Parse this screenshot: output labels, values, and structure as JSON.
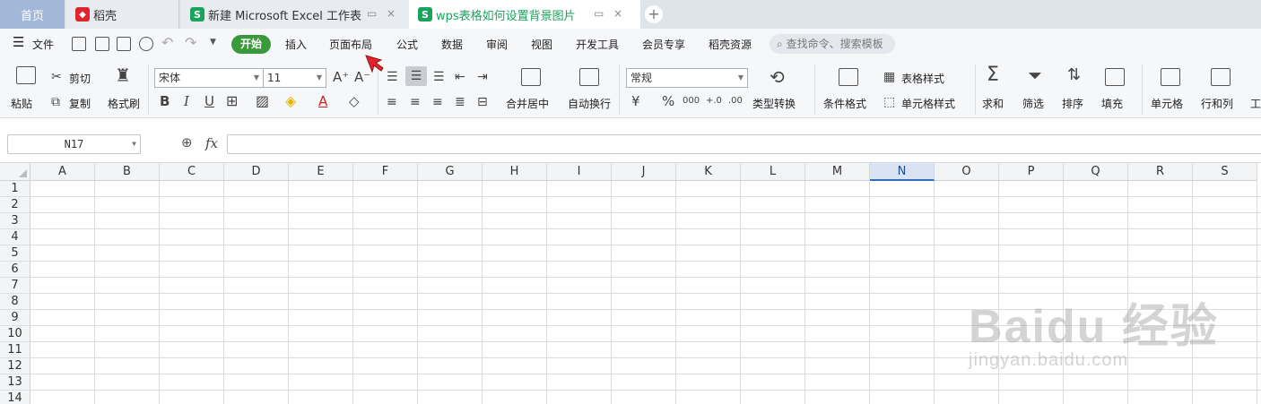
{
  "tabs": {
    "home": "首页",
    "daoke": "稻壳",
    "excel": "新建 Microsoft Excel 工作表",
    "active": "wps表格如何设置背景图片",
    "new_tab": "+",
    "close": "×"
  },
  "menu": {
    "file": "文件",
    "items": [
      "开始",
      "插入",
      "页面布局",
      "公式",
      "数据",
      "审阅",
      "视图",
      "开发工具",
      "会员专享",
      "稻壳资源"
    ],
    "search_placeholder": "查找命令、搜索模板"
  },
  "ribbon": {
    "paste": "粘贴",
    "cut": "剪切",
    "copy": "复制",
    "format_painter": "格式刷",
    "font_name": "宋体",
    "font_size": "11",
    "bold": "B",
    "italic": "I",
    "underline": "U",
    "merge_center": "合并居中",
    "wrap_text": "自动换行",
    "number_format": "常规",
    "currency": "¥",
    "percent": "%",
    "thousands": "000",
    "dec_inc": "+.0",
    "dec_dec": ".00",
    "type_convert": "类型转换",
    "conditional_format": "条件格式",
    "table_style": "表格样式",
    "cell_style": "单元格样式",
    "sum": "求和",
    "filter": "筛选",
    "sort": "排序",
    "fill": "填充",
    "cells": "单元格",
    "rows_cols": "行和列",
    "worksheet_partial": "工"
  },
  "formula": {
    "name_box": "N17",
    "fx": "fx",
    "value": ""
  },
  "grid": {
    "columns": [
      "A",
      "B",
      "C",
      "D",
      "E",
      "F",
      "G",
      "H",
      "I",
      "J",
      "K",
      "L",
      "M",
      "N",
      "O",
      "P",
      "Q",
      "R",
      "S"
    ],
    "rows": [
      "1",
      "2",
      "3",
      "4",
      "5",
      "6",
      "7",
      "8",
      "9",
      "10",
      "11",
      "12",
      "13",
      "14"
    ],
    "selected_column": "N"
  },
  "watermark": {
    "logo": "Baidu 经验",
    "sub": "jingyan.baidu.com"
  },
  "colors": {
    "accent_green": "#3a9a3b",
    "wps_green": "#1aa35c",
    "selected_col_border": "#2c6cc2",
    "cursor_red": "#e0262d"
  }
}
